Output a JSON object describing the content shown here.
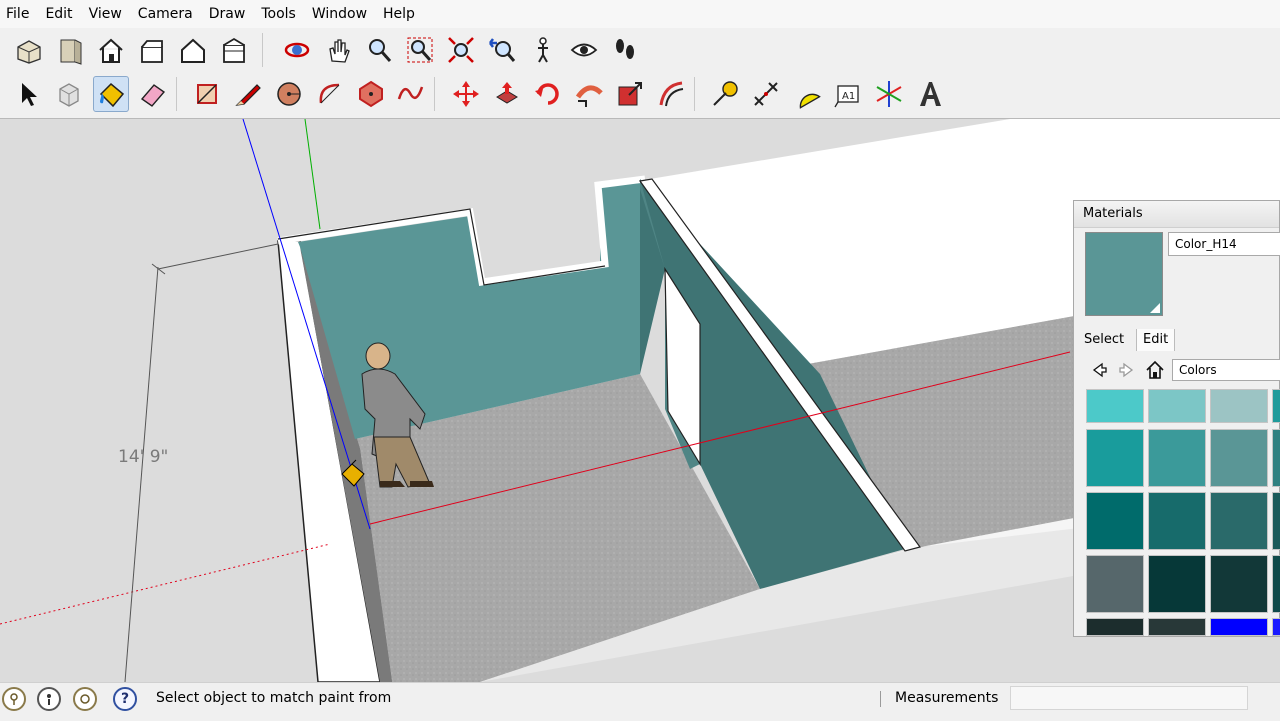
{
  "menu": [
    "File",
    "Edit",
    "View",
    "Camera",
    "Draw",
    "Tools",
    "Window",
    "Help"
  ],
  "toolbar_views": [
    {
      "icon": "iso-view-icon"
    },
    {
      "icon": "door-view-icon"
    },
    {
      "icon": "home-front-icon"
    },
    {
      "icon": "right-view-icon"
    },
    {
      "icon": "back-view-icon"
    },
    {
      "icon": "left-view-icon"
    },
    {
      "icon": "orbit-icon"
    },
    {
      "icon": "pan-icon"
    },
    {
      "icon": "zoom-icon"
    },
    {
      "icon": "zoom-window-icon"
    },
    {
      "icon": "zoom-extents-icon"
    },
    {
      "icon": "previous-view-icon"
    },
    {
      "icon": "position-camera-icon"
    },
    {
      "icon": "look-around-icon"
    },
    {
      "icon": "walk-icon"
    }
  ],
  "toolbar_tools": [
    {
      "icon": "select-arrow-icon"
    },
    {
      "icon": "make-component-icon"
    },
    {
      "icon": "paint-bucket-icon",
      "active": true
    },
    {
      "icon": "eraser-icon"
    },
    {
      "icon": "rectangle-icon"
    },
    {
      "icon": "pencil-line-icon"
    },
    {
      "icon": "circle-icon"
    },
    {
      "icon": "arc-icon"
    },
    {
      "icon": "polygon-icon"
    },
    {
      "icon": "freehand-icon"
    },
    {
      "icon": "move-icon"
    },
    {
      "icon": "push-pull-icon"
    },
    {
      "icon": "rotate-icon"
    },
    {
      "icon": "follow-me-icon"
    },
    {
      "icon": "scale-icon"
    },
    {
      "icon": "offset-icon"
    },
    {
      "icon": "tape-measure-icon"
    },
    {
      "icon": "dimension-icon"
    },
    {
      "icon": "protractor-icon"
    },
    {
      "icon": "text-icon"
    },
    {
      "icon": "axes-icon"
    },
    {
      "icon": "3d-text-icon"
    }
  ],
  "dimension": {
    "label": "14' 9\""
  },
  "materials": {
    "title": "Materials",
    "name": "Color_H14",
    "preview_color": "#5a9696",
    "tabs": [
      "Select",
      "Edit"
    ],
    "library": "Colors",
    "swatches": [
      [
        "#4cc9c9",
        "#7cc6c6",
        "#9cc4c4",
        "#1f9a9a"
      ],
      [
        "#199c9c",
        "#3b9a9a",
        "#5a9696",
        "#2f8080"
      ],
      [
        "#006b6b",
        "#176b6b",
        "#2a6a6a",
        "#1a5a5a"
      ],
      [
        "#56676b",
        "#063838",
        "#123838",
        "#0f4a4a"
      ],
      [
        "#1c2d2d",
        "#283838",
        "#0000ff",
        "#1a1aff"
      ]
    ]
  },
  "status": {
    "message": "Select object to match paint from",
    "measurements_label": "Measurements",
    "measurements_value": ""
  },
  "colors": {
    "wall": "#5a9696",
    "wall_dark": "#3f6e6e",
    "floor": "#a9a9a9",
    "axis_red": "#e0001b",
    "axis_green": "#00b000",
    "axis_blue": "#0000ff"
  }
}
